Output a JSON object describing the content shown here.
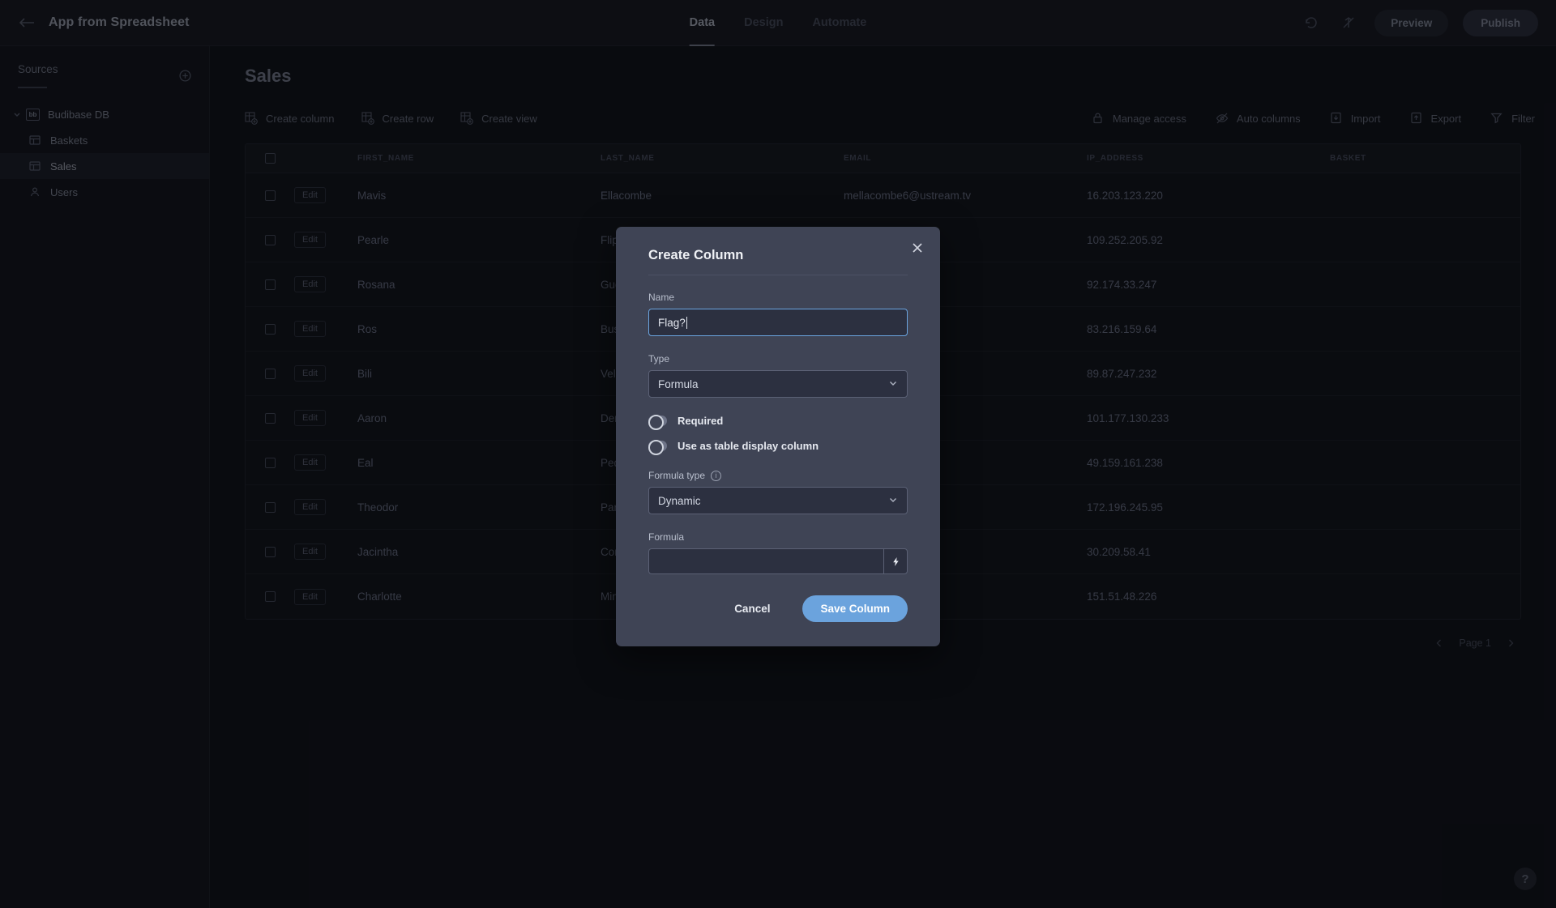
{
  "app": {
    "title": "App from Spreadsheet",
    "back_icon": "back-arrow-icon"
  },
  "nav": {
    "tabs": [
      {
        "label": "Data",
        "active": true
      },
      {
        "label": "Design",
        "active": false
      },
      {
        "label": "Automate",
        "active": false
      }
    ],
    "undo_icon": "undo-icon",
    "redo_icon": "redo-icon",
    "preview_label": "Preview",
    "publish_label": "Publish"
  },
  "sidebar": {
    "heading": "Sources",
    "add_icon": "plus-circle-icon",
    "items": [
      {
        "label": "Budibase DB",
        "icon": "budibase-db-icon",
        "level": 0,
        "selected": false
      },
      {
        "label": "Baskets",
        "icon": "table-icon",
        "level": 1,
        "selected": false
      },
      {
        "label": "Sales",
        "icon": "table-icon",
        "level": 1,
        "selected": true
      },
      {
        "label": "Users",
        "icon": "users-icon",
        "level": 1,
        "selected": false
      }
    ]
  },
  "main": {
    "page_title": "Sales",
    "toolbar_left": [
      {
        "label": "Create column",
        "icon": "create-column-icon"
      },
      {
        "label": "Create row",
        "icon": "create-row-icon"
      },
      {
        "label": "Create view",
        "icon": "create-view-icon"
      }
    ],
    "toolbar_right": [
      {
        "label": "Manage access",
        "icon": "lock-icon"
      },
      {
        "label": "Auto columns",
        "icon": "eye-off-icon"
      },
      {
        "label": "Import",
        "icon": "import-icon"
      },
      {
        "label": "Export",
        "icon": "export-icon"
      },
      {
        "label": "Filter",
        "icon": "filter-icon"
      }
    ],
    "table": {
      "columns": [
        "FIRST_NAME",
        "LAST_NAME",
        "EMAIL",
        "IP_ADDRESS",
        "BASKET"
      ],
      "edit_label": "Edit",
      "rows": [
        {
          "first_name": "Mavis",
          "last_name": "Ellacombe",
          "email": "mellacombe6@ustream.tv",
          "ip_address": "16.203.123.220",
          "basket": ""
        },
        {
          "first_name": "Pearle",
          "last_name": "Flippini",
          "email": "",
          "ip_address": "109.252.205.92",
          "basket": ""
        },
        {
          "first_name": "Rosana",
          "last_name": "Gudeman",
          "email": "",
          "ip_address": "92.174.33.247",
          "basket": ""
        },
        {
          "first_name": "Ros",
          "last_name": "Bussel",
          "email": "",
          "ip_address": "83.216.159.64",
          "basket": ""
        },
        {
          "first_name": "Bili",
          "last_name": "Vellacott",
          "email": "",
          "ip_address": "89.87.247.232",
          "basket": ""
        },
        {
          "first_name": "Aaron",
          "last_name": "Denniss",
          "email": "",
          "ip_address": "101.177.130.233",
          "basket": ""
        },
        {
          "first_name": "Eal",
          "last_name": "Pedroli",
          "email": "",
          "ip_address": "49.159.161.238",
          "basket": ""
        },
        {
          "first_name": "Theodor",
          "last_name": "Parren",
          "email": "",
          "ip_address": "172.196.245.95",
          "basket": ""
        },
        {
          "first_name": "Jacintha",
          "last_name": "Connach",
          "email": "",
          "ip_address": "30.209.58.41",
          "basket": ""
        },
        {
          "first_name": "Charlotte",
          "last_name": "Minelli",
          "email": "",
          "ip_address": "151.51.48.226",
          "basket": ""
        }
      ]
    },
    "pagination": {
      "prev_icon": "chevron-left-icon",
      "page_label": "Page 1",
      "next_icon": "chevron-right-icon"
    },
    "help_label": "?"
  },
  "modal": {
    "title": "Create Column",
    "close_icon": "close-icon",
    "name": {
      "label": "Name",
      "value": "Flag?",
      "placeholder": ""
    },
    "type": {
      "label": "Type",
      "value": "Formula"
    },
    "required_toggle": {
      "label": "Required",
      "on": false
    },
    "display_toggle": {
      "label": "Use as table display column",
      "on": false
    },
    "formula_type": {
      "label": "Formula type",
      "value": "Dynamic",
      "info_icon": "info-icon"
    },
    "formula": {
      "label": "Formula",
      "value": "",
      "binding_icon": "lightning-bolt-icon"
    },
    "cancel_label": "Cancel",
    "save_label": "Save Column"
  },
  "colors": {
    "accent": "#6ba3dd",
    "modal_bg": "#3f4455",
    "app_bg": "#0d0e13"
  }
}
